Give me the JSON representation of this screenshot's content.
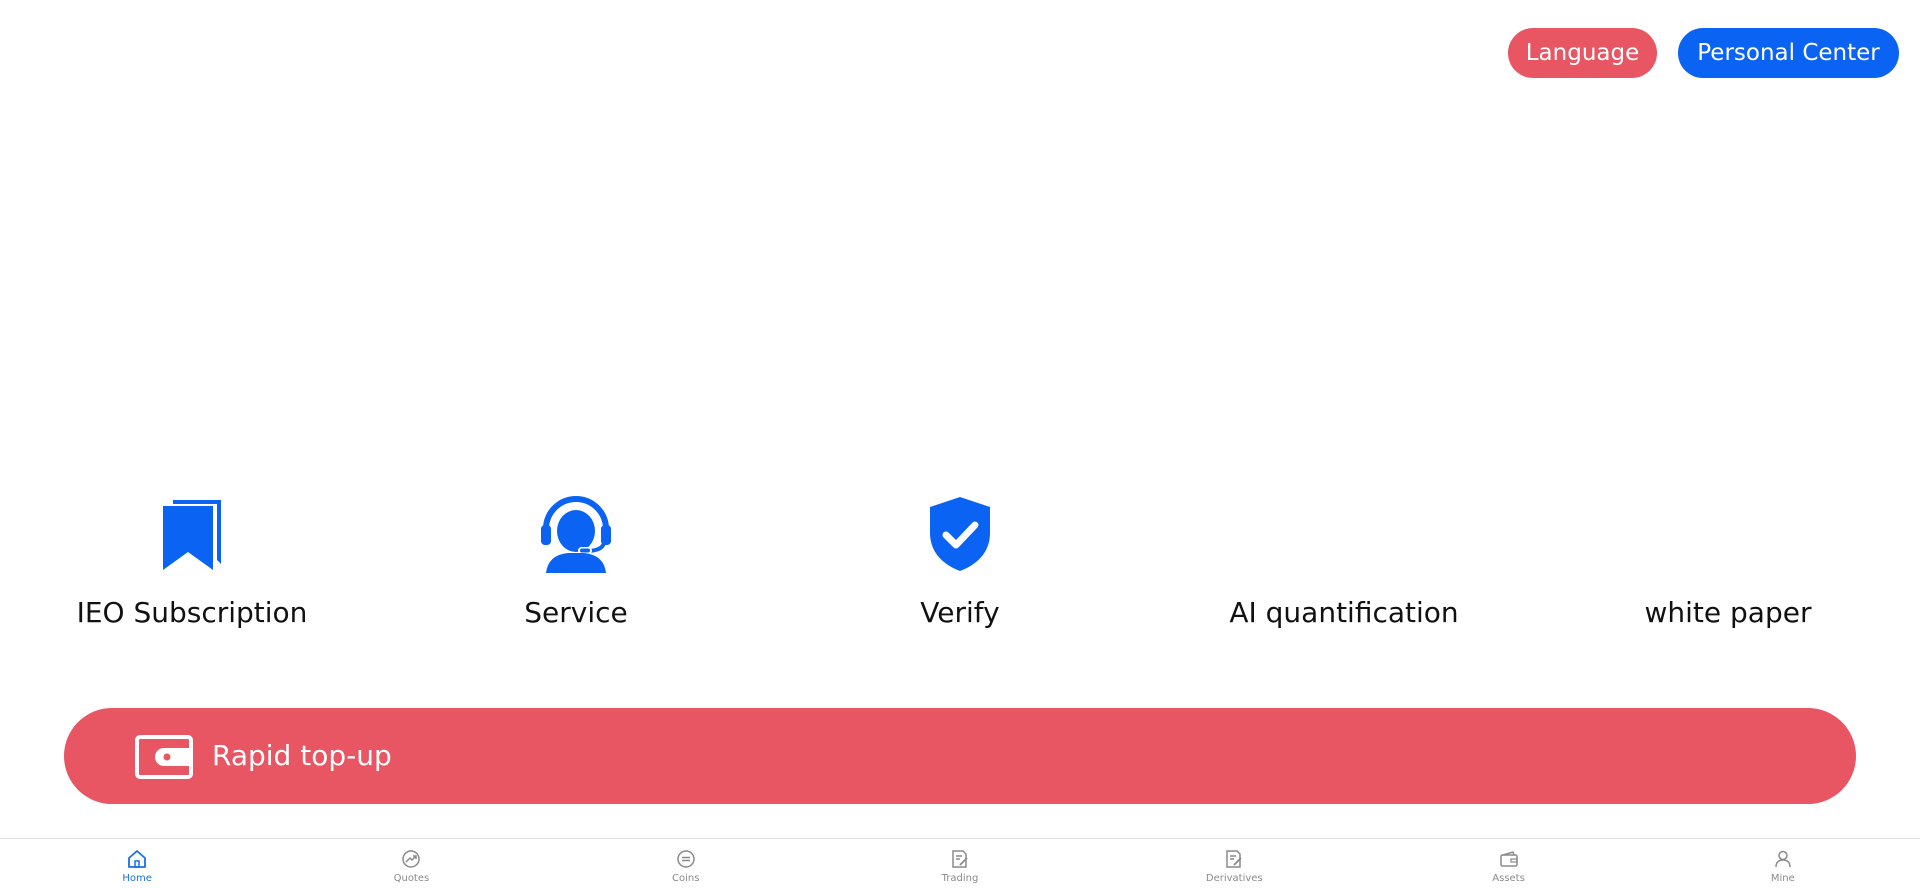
{
  "header": {
    "language_label": "Language",
    "personal_center_label": "Personal Center"
  },
  "features": [
    {
      "label": "IEO Subscription",
      "icon": "bookmark-icon"
    },
    {
      "label": "Service",
      "icon": "headset-icon"
    },
    {
      "label": "Verify",
      "icon": "shield-check-icon"
    },
    {
      "label": "AI quantification",
      "icon": ""
    },
    {
      "label": "white paper",
      "icon": ""
    }
  ],
  "topup": {
    "label": "Rapid top-up",
    "icon": "wallet-icon"
  },
  "tabbar": {
    "active": "Home",
    "items": [
      {
        "label": "Home",
        "icon": "home-icon"
      },
      {
        "label": "Quotes",
        "icon": "quotes-icon"
      },
      {
        "label": "Coins",
        "icon": "coins-icon"
      },
      {
        "label": "Trading",
        "icon": "trading-icon"
      },
      {
        "label": "Derivatives",
        "icon": "derivatives-icon"
      },
      {
        "label": "Assets",
        "icon": "assets-icon"
      },
      {
        "label": "Mine",
        "icon": "user-icon"
      }
    ]
  },
  "colors": {
    "accent_red": "#e85563",
    "accent_blue": "#0b63f3",
    "tab_active": "#1a6fe6",
    "tab_inactive": "#8a8a8a"
  }
}
